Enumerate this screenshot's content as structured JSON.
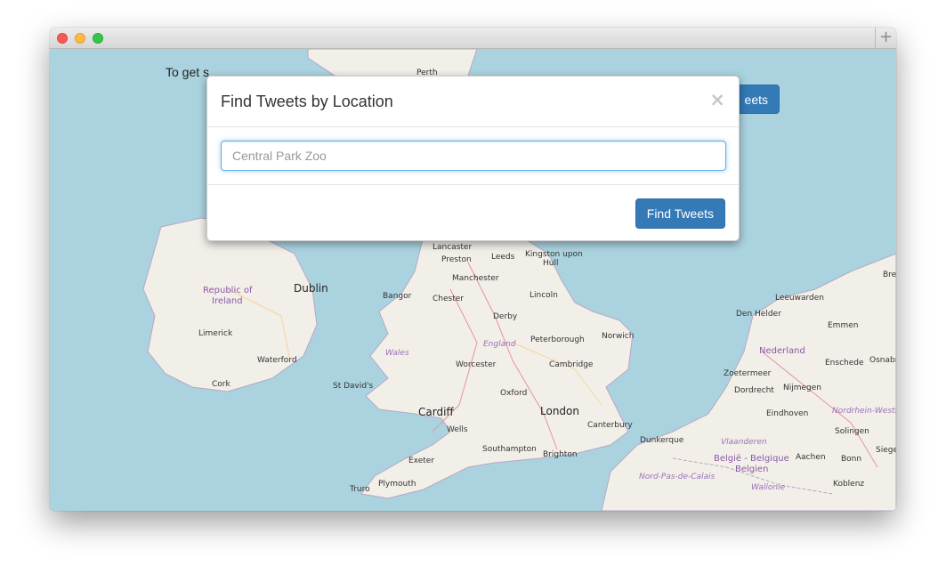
{
  "window": {
    "new_tab_glyph": "+"
  },
  "page": {
    "intro_text": "To get s",
    "background_button_label": "eets"
  },
  "modal": {
    "title": "Find Tweets by Location",
    "close_glyph": "×",
    "search": {
      "value": "",
      "placeholder": "Central Park Zoo"
    },
    "submit_label": "Find Tweets"
  },
  "map": {
    "labels": {
      "perth": "Perth",
      "republic_of": "Republic of",
      "ireland": "Ireland",
      "dublin": "Dublin",
      "limerick": "Limerick",
      "waterford": "Waterford",
      "cork": "Cork",
      "lancaster": "Lancaster",
      "preston": "Preston",
      "leeds": "Leeds",
      "kingston_upon": "Kingston upon",
      "hull": "Hull",
      "manchester": "Manchester",
      "bangor": "Bangor",
      "chester": "Chester",
      "lincoln": "Lincoln",
      "derby": "Derby",
      "england": "England",
      "peterborough": "Peterborough",
      "norwich": "Norwich",
      "wales": "Wales",
      "worcester": "Worcester",
      "cambridge": "Cambridge",
      "st_davids": "St David's",
      "oxford": "Oxford",
      "cardiff": "Cardiff",
      "london": "London",
      "wells": "Wells",
      "canterbury": "Canterbury",
      "southampton": "Southampton",
      "brighton": "Brighton",
      "exeter": "Exeter",
      "plymouth": "Plymouth",
      "truro": "Truro",
      "dunkerque": "Dunkerque",
      "nord_pas_de_calais": "Nord-Pas-de-Calais",
      "vlaanderen": "Vlaanderen",
      "belgie_belgique": "België - Belgique",
      "belgien": "Belgien",
      "wallonie": "Wallonie",
      "den_helder": "Den Helder",
      "leeuwarden": "Leeuwarden",
      "emmen": "Emmen",
      "nederland": "Nederland",
      "enschede": "Enschede",
      "osnabr": "Osnabr",
      "zoetermeer": "Zoetermeer",
      "dordrecht": "Dordrecht",
      "nijmegen": "Nijmegen",
      "eindhoven": "Eindhoven",
      "nordrhein_westfa": "Nordrhein-Westfa",
      "solingen": "Solingen",
      "aachen": "Aachen",
      "bonn": "Bonn",
      "siege": "Siege",
      "koblenz": "Koblenz",
      "bre": "Bre"
    }
  }
}
